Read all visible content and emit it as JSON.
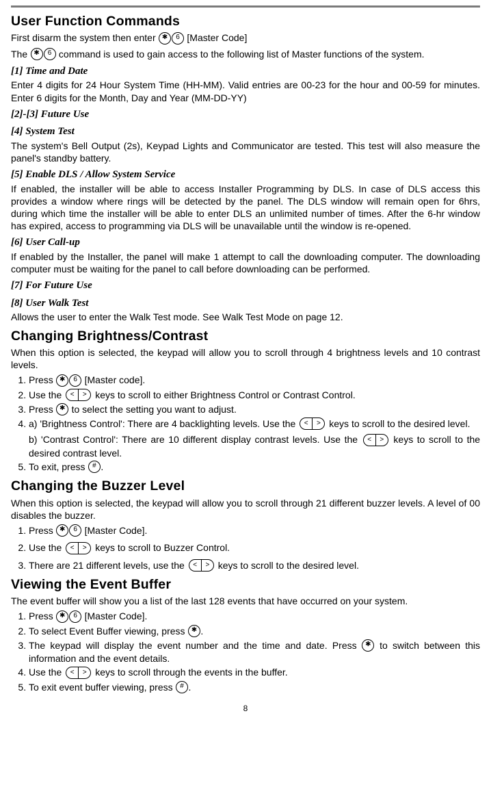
{
  "h_userfunc": "User Function Commands",
  "p_disarm": "First disarm the system then enter",
  "p_disarm_tail": "[Master Code]",
  "p_command1": "The",
  "p_command2": "command is used to gain access to the following list of Master functions of the system.",
  "s1_h": "[1] Time and Date",
  "s1_p": "Enter 4 digits for 24 Hour System Time (HH-MM).  Valid entries are 00-23 for the hour and 00-59 for minutes.  Enter 6 digits for the Month, Day and Year (MM-DD-YY)",
  "s23_h": "[2]-[3] Future Use",
  "s4_h": "[4] System Test",
  "s4_p": "The system's Bell Output (2s), Keypad Lights and Communicator are tested. This test will also measure the panel's standby battery.",
  "s5_h": "[5] Enable DLS / Allow System Service",
  "s5_p": "If enabled, the installer will be able to access Installer Programming by DLS. In case of DLS access this provides a window where rings will be detected by the panel. The DLS window will remain open for 6hrs, during which time the installer will be able to enter DLS an unlimited number of times.  After the 6-hr window has expired, access to programming via DLS will be unavailable until the window is re-opened.",
  "s6_h": "[6] User Call-up",
  "s6_p": "If enabled by the Installer, the panel will make 1 attempt to call the downloading computer.  The downloading computer must be waiting for the panel to call before downloading can be performed.",
  "s7_h": "[7] For Future Use",
  "s8_h": "[8] User Walk Test",
  "s8_p": "Allows the user to enter the Walk Test mode. See Walk Test Mode on page 12.",
  "h_bright": "Changing Brightness/Contrast",
  "bright_p": "When this option is selected, the keypad will allow you to scroll through 4 brightness levels and 10 contrast levels.",
  "bright_li1a": "Press",
  "bright_li1b": "[Master code].",
  "bright_li2a": "Use the",
  "bright_li2b": "keys to scroll to either Brightness Control or Contrast Control.",
  "bright_li3a": "Press",
  "bright_li3b": "to select the setting you want to adjust.",
  "bright_li4a": "a) 'Brightness Control': There are 4 backlighting levels. Use the",
  "bright_li4b": "keys to scroll to the desired level.",
  "bright_li4c": "b) 'Contrast Control': There are 10 different display contrast levels. Use the",
  "bright_li4d": "keys to scroll to the desired contrast level.",
  "bright_li5a": "To exit, press",
  "bright_li5b": ".",
  "h_buzz": "Changing the Buzzer Level",
  "buzz_p": "When this option is selected, the keypad will allow you to scroll through 21 different buzzer levels.  A level of 00 disables the buzzer.",
  "buzz_li1a": "Press",
  "buzz_li1b": "[Master Code].",
  "buzz_li2a": "Use the",
  "buzz_li2b": "keys to scroll to Buzzer Control.",
  "buzz_li3a": "There are 21 different levels, use the",
  "buzz_li3b": "keys to scroll to the desired level.",
  "h_event": "Viewing the Event Buffer",
  "event_p": "The event buffer will show you a list of the last 128 events that have occurred on your system.",
  "event_li1a": "Press",
  "event_li1b": "[Master Code].",
  "event_li2a": "To select Event Buffer viewing, press",
  "event_li2b": ".",
  "event_li3a": "The keypad will display the event number and the time and date. Press",
  "event_li3b": "to switch between this information and the event details.",
  "event_li4a": "Use the",
  "event_li4b": "keys to scroll through the events in the buffer.",
  "event_li5a": "To exit event buffer viewing, press",
  "event_li5b": ".",
  "keys": {
    "star": "✱",
    "six": "6",
    "hash": "#"
  },
  "arrows": {
    "left": "<",
    "right": ">"
  },
  "page_num": "8"
}
